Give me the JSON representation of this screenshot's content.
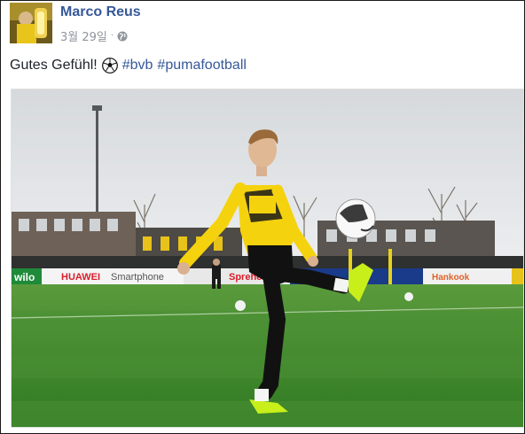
{
  "post": {
    "author": "Marco Reus",
    "date": "3월 29일",
    "separator": "·",
    "text_plain": "Gutes Gefühl!",
    "emoji": "soccer-ball-emoji",
    "hashtags": [
      "#bvb",
      "#pumafootball"
    ]
  },
  "photo": {
    "ad_boards": [
      "HUAWEI",
      "Smartphone",
      "Sprehe",
      "Hankook",
      "wilo"
    ]
  },
  "colors": {
    "link": "#365899",
    "meta": "#90949c",
    "text": "#1d2129",
    "jersey": "#f5d20e",
    "grass": "#3e8a2a"
  }
}
